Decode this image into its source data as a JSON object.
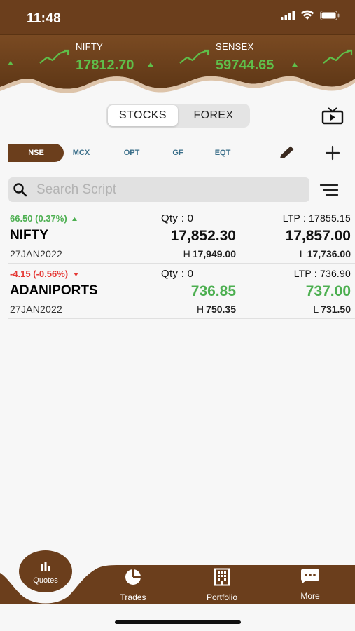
{
  "status_bar": {
    "time": "11:48"
  },
  "tickers": [
    {
      "name": "NIFTY",
      "value": "17812.70",
      "direction": "up"
    },
    {
      "name": "SENSEX",
      "value": "59744.65",
      "direction": "up"
    }
  ],
  "segment_tabs": [
    {
      "label": "STOCKS",
      "selected": true
    },
    {
      "label": "FOREX",
      "selected": false
    }
  ],
  "exchange_tabs": [
    {
      "label": "NSE",
      "selected": true
    },
    {
      "label": "MCX",
      "selected": false
    },
    {
      "label": "OPT",
      "selected": false
    },
    {
      "label": "GF",
      "selected": false
    },
    {
      "label": "EQT",
      "selected": false
    }
  ],
  "search": {
    "placeholder": "Search Script",
    "value": ""
  },
  "quotes": [
    {
      "change": "66.50 (0.37%)",
      "change_direction": "up",
      "qty": "Qty : 0",
      "ltp": "LTP : 17855.15",
      "symbol": "NIFTY",
      "bid": "17,852.30",
      "ask": "17,857.00",
      "expiry": "27JAN2022",
      "high_prefix": "H",
      "high": "17,949.00",
      "low_prefix": "L",
      "low": "17,736.00"
    },
    {
      "change": "-4.15 (-0.56%)",
      "change_direction": "down",
      "qty": "Qty : 0",
      "ltp": "LTP : 736.90",
      "symbol": "ADANIPORTS",
      "bid": "736.85",
      "ask": "737.00",
      "expiry": "27JAN2022",
      "high_prefix": "H",
      "high": "750.35",
      "low_prefix": "L",
      "low": "731.50"
    }
  ],
  "tabbar": {
    "items": [
      {
        "label": "Quotes",
        "icon": "bar-chart-icon",
        "selected": true
      },
      {
        "label": "Trades",
        "icon": "pie-chart-icon",
        "selected": false
      },
      {
        "label": "Portfolio",
        "icon": "building-icon",
        "selected": false
      },
      {
        "label": "More",
        "icon": "chat-bubble-icon",
        "selected": false
      }
    ]
  },
  "colors": {
    "brand_brown": "#6b3e1c",
    "up_green": "#4caf50",
    "down_red": "#e53935",
    "ticker_green": "#5fbf4a"
  }
}
